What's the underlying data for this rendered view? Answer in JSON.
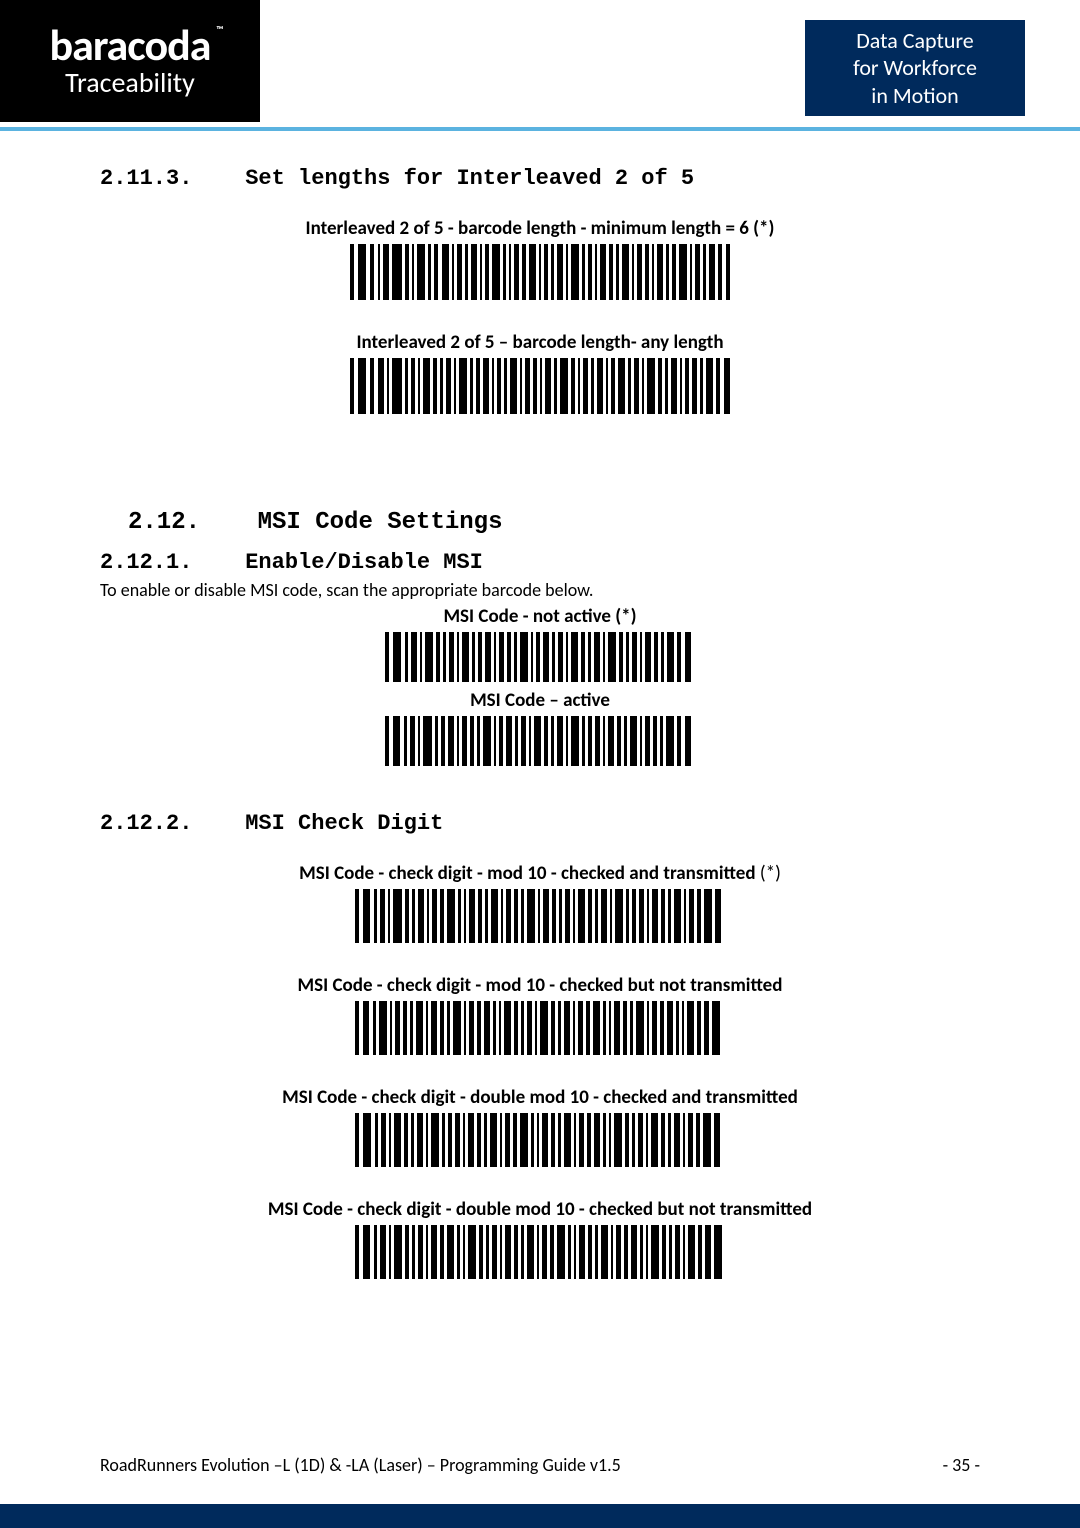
{
  "header": {
    "brand": "baracoda",
    "brand_tm": "™",
    "brand_sub": "Traceability",
    "tagline_line1": "Data Capture",
    "tagline_line2": "for Workforce",
    "tagline_line3": "in Motion"
  },
  "sections": {
    "s2113": {
      "num": "2.11.3.",
      "title": "Set lengths for Interleaved 2 of 5"
    },
    "s212": {
      "num": "2.12.",
      "title": "MSI Code Settings"
    },
    "s2121": {
      "num": "2.12.1.",
      "title": "Enable/Disable MSI",
      "para": "To enable or disable MSI code, scan the appropriate barcode below."
    },
    "s2122": {
      "num": "2.12.2.",
      "title": "MSI Check Digit"
    }
  },
  "barcodes": {
    "i2of5_min6": "Interleaved 2 of 5 - barcode length - minimum length = 6 (*)",
    "i2of5_any": "Interleaved 2 of 5 – barcode length-  any length",
    "msi_not_active": "MSI Code - not active (*)",
    "msi_active": "MSI Code – active",
    "msi_cd_mod10_tx_pre": "MSI Code - check digit - mod 10 - checked and transmitted",
    "msi_cd_mod10_tx_ast": " (*)",
    "msi_cd_mod10_notx": "MSI Code - check digit - mod 10 - checked but not transmitted",
    "msi_cd_dmod10_tx": "MSI Code - check digit - double mod 10 - checked and transmitted",
    "msi_cd_dmod10_notx": "MSI Code - check digit - double mod 10 - checked but not transmitted"
  },
  "footer": {
    "left": "RoadRunners Evolution –L (1D) & -LA (Laser) – Programming Guide v1.5",
    "right": "- 35 -"
  }
}
